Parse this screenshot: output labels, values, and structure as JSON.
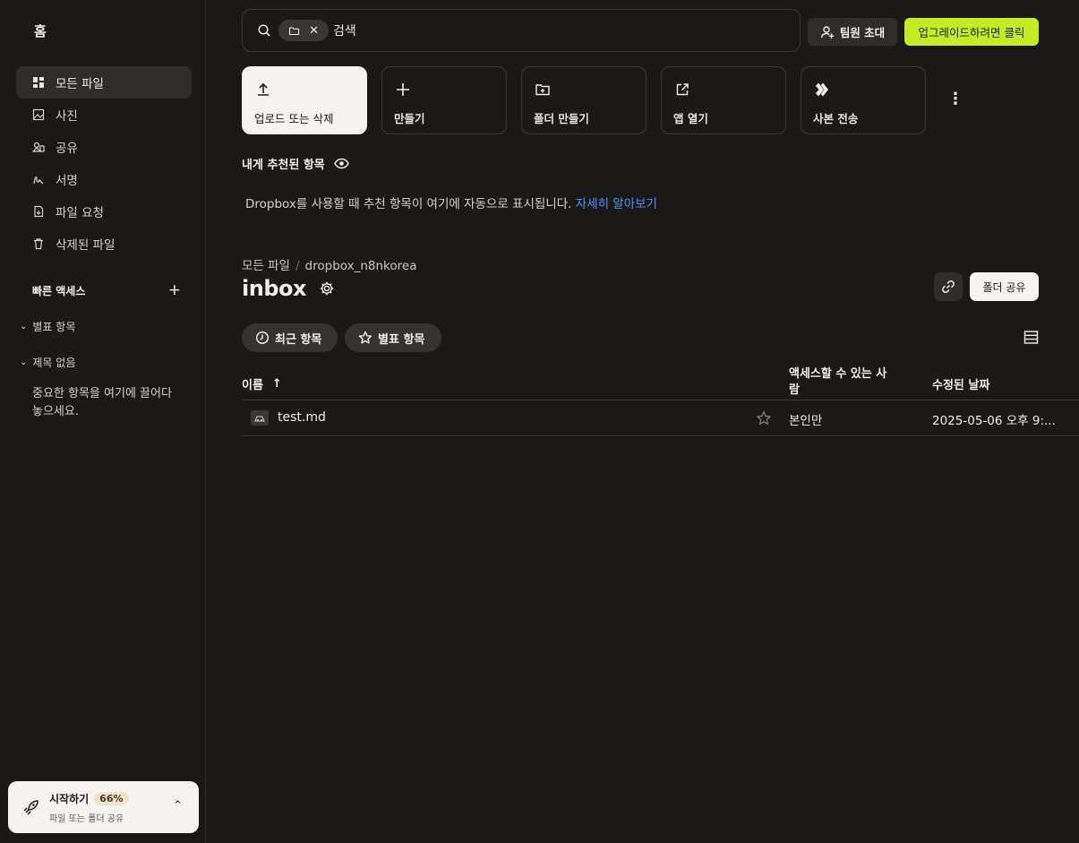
{
  "sidebar": {
    "home_title": "홈",
    "nav": [
      {
        "label": "모든 파일",
        "icon": "all-files-icon",
        "active": true
      },
      {
        "label": "사진",
        "icon": "photo-icon",
        "active": false
      },
      {
        "label": "공유",
        "icon": "shared-icon",
        "active": false
      },
      {
        "label": "서명",
        "icon": "signature-icon",
        "active": false
      },
      {
        "label": "파일 요청",
        "icon": "file-request-icon",
        "active": false
      },
      {
        "label": "삭제된 파일",
        "icon": "trash-icon",
        "active": false
      }
    ],
    "quick_access": {
      "label": "빠른 액세스",
      "add": "+"
    },
    "starred_section": "별표 항목",
    "untitled_section": "제목 없음",
    "drop_hint": "중요한 항목을 여기에 끌어다 놓으세요.",
    "onboarding": {
      "title": "시작하기",
      "percent": "66%",
      "subtitle": "파일 또는 폴더 공유"
    }
  },
  "topbar": {
    "search_placeholder": "검색",
    "invite_label": "팀원 초대",
    "upgrade_label": "업그레이드하려면 클릭",
    "upgrade_color": "#c3ec23"
  },
  "actions": [
    {
      "label": "업로드 또는 삭제",
      "icon": "upload-icon"
    },
    {
      "label": "만들기",
      "icon": "plus-icon"
    },
    {
      "label": "폴더 만들기",
      "icon": "new-folder-icon"
    },
    {
      "label": "앱 열기",
      "icon": "open-app-icon"
    },
    {
      "label": "사본 전송",
      "icon": "transfer-icon"
    }
  ],
  "recommended": {
    "title": "내게 추천된 항목",
    "text": "Dropbox를 사용할 때 추천 항목이 여기에 자동으로 표시됩니다.",
    "link": "자세히 알아보기"
  },
  "breadcrumb": {
    "root": "모든 파일",
    "sep": "/",
    "parent": "dropbox_n8nkorea"
  },
  "folder": {
    "title": "inbox",
    "share_label": "폴더 공유"
  },
  "filters": {
    "recent": "최근 항목",
    "starred": "별표 항목"
  },
  "table": {
    "col_name": "이름",
    "col_access": "액세스할 수 있는 사람",
    "col_modified": "수정된 날짜",
    "rows": [
      {
        "name": "test.md",
        "access": "본인만",
        "modified": "2025-05-06 오후 9:..."
      }
    ]
  }
}
